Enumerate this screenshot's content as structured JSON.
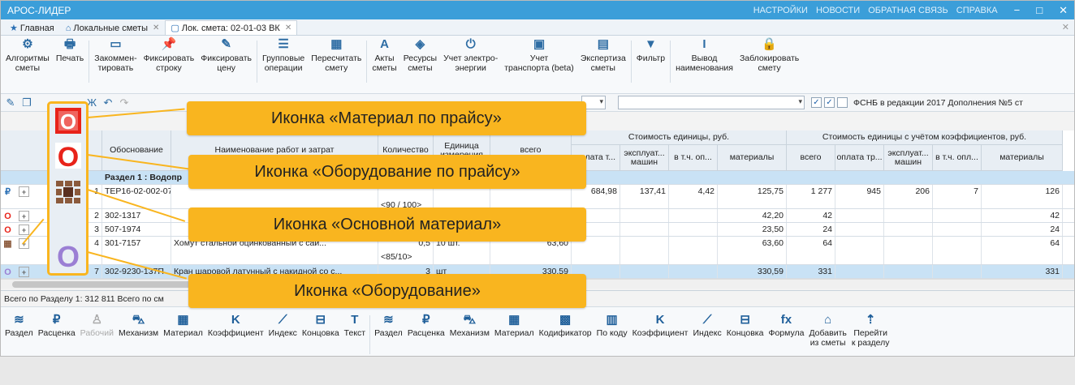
{
  "app": {
    "title": "АРОС-ЛИДЕР"
  },
  "menu": {
    "items": [
      "НАСТРОЙКИ",
      "НОВОСТИ",
      "ОБРАТНАЯ СВЯЗЬ",
      "СПРАВКА"
    ]
  },
  "tabs": [
    {
      "label": "Главная"
    },
    {
      "label": "Локальные сметы"
    },
    {
      "label": "Лок. смета: 02-01-03 ВК"
    }
  ],
  "ribbon": [
    {
      "icon": "gear-icon",
      "l1": "Алгоритмы",
      "l2": "сметы"
    },
    {
      "icon": "printer-icon",
      "l1": "Печать",
      "l2": ""
    },
    {
      "icon": "comment-icon",
      "l1": "Закоммен-",
      "l2": "тировать"
    },
    {
      "icon": "pin-icon",
      "l1": "Фиксировать",
      "l2": "строку"
    },
    {
      "icon": "pencil-icon",
      "l1": "Фиксировать",
      "l2": "цену"
    },
    {
      "icon": "list-icon",
      "l1": "Групповые",
      "l2": "операции"
    },
    {
      "icon": "calc-icon",
      "l1": "Пересчитать",
      "l2": "смету"
    },
    {
      "icon": "a-icon",
      "l1": "Акты",
      "l2": "сметы"
    },
    {
      "icon": "cube-icon",
      "l1": "Ресурсы",
      "l2": "сметы"
    },
    {
      "icon": "power-icon",
      "l1": "Учет электро-",
      "l2": "энергии"
    },
    {
      "icon": "map-icon",
      "l1": "Учет",
      "l2": "транспорта (beta)"
    },
    {
      "icon": "doc-icon",
      "l1": "Экспертиза",
      "l2": "сметы"
    },
    {
      "icon": "funnel-icon",
      "l1": "Фильтр",
      "l2": ""
    },
    {
      "icon": "text-cursor-icon",
      "l1": "Вывод",
      "l2": "наименования"
    },
    {
      "icon": "lock-icon",
      "l1": "Заблокировать",
      "l2": "смету"
    }
  ],
  "norm": {
    "label": "ФСНБ в редакции 2017 Дополнения №5 ст"
  },
  "grid": {
    "headers": {
      "basis": "Обоснование",
      "name": "Наименование работ и затрат",
      "qty": "Количество",
      "unit": "Единица измерения",
      "total": "всего",
      "unit_cost": "Стоимость единицы, руб.",
      "unit_cost_k": "Стоимость единицы с учётом коэффициентов, руб.",
      "pay": "оплата т...",
      "machine": "эксплуат... машин",
      "incl": "в т.ч. оп...",
      "mat": "материалы",
      "total2": "всего",
      "pay2": "оплата тр...",
      "machine2": "эксплуат... машин",
      "incl2": "в т.ч. опл...",
      "mat2": "материалы"
    },
    "section": "Раздел 1 : Водопр",
    "rows": [
      {
        "n": "1",
        "code": "ТЕР16-02-002-07",
        "name": "",
        "sub": "<90 / 100>",
        "qty": "",
        "unit": "",
        "total": "",
        "pay": "684,98",
        "machine": "137,41",
        "incl": "4,42",
        "mat": "125,75",
        "t2": "1 277",
        "p2": "945",
        "m2": "206",
        "i2": "7",
        "mt2": "126"
      },
      {
        "n": "2",
        "code": "302-1317",
        "name": "",
        "sub": "",
        "qty": "",
        "unit": "",
        "total": "",
        "pay": "",
        "machine": "",
        "incl": "",
        "mat": "42,20",
        "t2": "42",
        "p2": "",
        "m2": "",
        "i2": "",
        "mt2": "42"
      },
      {
        "n": "3",
        "code": "507-1974",
        "name": "",
        "sub": "",
        "qty": "",
        "unit": "",
        "total": "",
        "pay": "",
        "machine": "",
        "incl": "",
        "mat": "23,50",
        "t2": "24",
        "p2": "",
        "m2": "",
        "i2": "",
        "mt2": "24"
      },
      {
        "n": "4",
        "code": "301-7157",
        "name": "Хомут стальной оцинкованный с сай...",
        "sub": "<85/10>",
        "qty": "0,5",
        "unit": "10 шт.",
        "total": "63,60",
        "pay": "",
        "machine": "",
        "incl": "",
        "mat": "63,60",
        "t2": "64",
        "p2": "",
        "m2": "",
        "i2": "",
        "mt2": "64"
      },
      {
        "n": "7",
        "code": "302-9230-137П",
        "name": "Кран шаровой латунный с накидной со с...",
        "sub": "",
        "qty": "3",
        "unit": "шт",
        "total": "330,59",
        "pay": "",
        "machine": "",
        "incl": "",
        "mat": "330,59",
        "t2": "331",
        "p2": "",
        "m2": "",
        "i2": "",
        "mt2": "331"
      }
    ]
  },
  "status": {
    "text": "Всего по Разделу 1: 312 811  Всего по см"
  },
  "bottom_left": [
    {
      "icon": "stack-icon",
      "label": "Раздел"
    },
    {
      "icon": "ruble-icon",
      "label": "Расценка"
    },
    {
      "icon": "worker-icon",
      "label": "Рабочий",
      "disabled": true
    },
    {
      "icon": "car-icon",
      "label": "Механизм"
    },
    {
      "icon": "bricks-icon",
      "label": "Материал"
    },
    {
      "icon": "k-icon",
      "label": "Коэффициент"
    },
    {
      "icon": "chart-icon",
      "label": "Индекс"
    },
    {
      "icon": "end-icon",
      "label": "Концовка"
    },
    {
      "icon": "t-icon",
      "label": "Текст"
    }
  ],
  "bottom_right": [
    {
      "icon": "stack-icon",
      "label": "Раздел"
    },
    {
      "icon": "ruble-icon",
      "label": "Расценка"
    },
    {
      "icon": "car-icon",
      "label": "Механизм"
    },
    {
      "icon": "bricks-icon",
      "label": "Материал"
    },
    {
      "icon": "codifier-icon",
      "label": "Кодификатор"
    },
    {
      "icon": "barcode-icon",
      "label": "По коду"
    },
    {
      "icon": "k-icon",
      "label": "Коэффициент"
    },
    {
      "icon": "chart-icon",
      "label": "Индекс"
    },
    {
      "icon": "end-icon",
      "label": "Концовка"
    },
    {
      "icon": "fx-icon",
      "label": "Формула"
    },
    {
      "icon": "home-add-icon",
      "label": "Добавить",
      "label2": "из сметы"
    },
    {
      "icon": "up-icon",
      "label": "Перейти",
      "label2": "к разделу"
    }
  ],
  "callouts": [
    {
      "text": "Иконка «Материал по прайсу»"
    },
    {
      "text": "Иконка «Оборудование по прайсу»"
    },
    {
      "text": "Иконка «Основной материал»"
    },
    {
      "text": "Иконка «Оборудование»"
    }
  ],
  "colors": {
    "titlebar": "#3b9ed9",
    "callout": "#f9b51f",
    "equipment_red": "#e8231a",
    "equipment_violet": "#9b7fd4",
    "material_brown": "#8b5a3c"
  }
}
